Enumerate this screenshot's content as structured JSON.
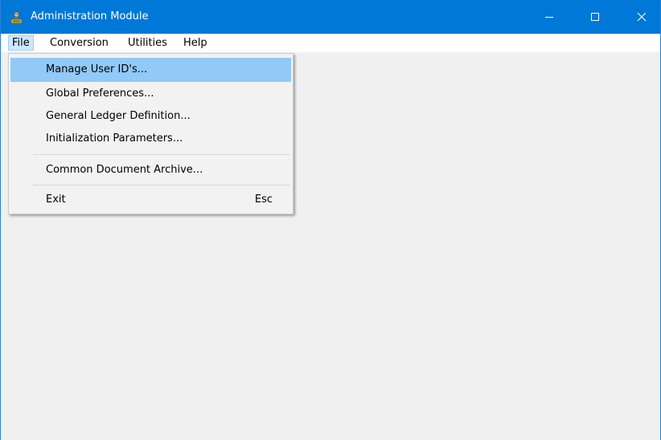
{
  "window": {
    "title": "Administration Module",
    "app_icon": "sage-app-icon",
    "accent": "#0078d7"
  },
  "titlebar_buttons": {
    "minimize": "minimize-icon",
    "maximize": "maximize-icon",
    "close": "close-icon"
  },
  "menubar": {
    "items": [
      {
        "label": "File",
        "open": true
      },
      {
        "label": "Conversion"
      },
      {
        "label": "Utilities"
      },
      {
        "label": "Help"
      }
    ]
  },
  "file_menu": {
    "items": [
      {
        "label": "Manage User ID's...",
        "highlighted": true
      },
      {
        "label": "Global Preferences..."
      },
      {
        "label": "General Ledger Definition..."
      },
      {
        "label": "Initialization Parameters..."
      },
      {
        "label": "Common Document Archive..."
      },
      {
        "label": "Exit",
        "shortcut": "Esc"
      }
    ],
    "highlight_color": "#91c9f7"
  }
}
